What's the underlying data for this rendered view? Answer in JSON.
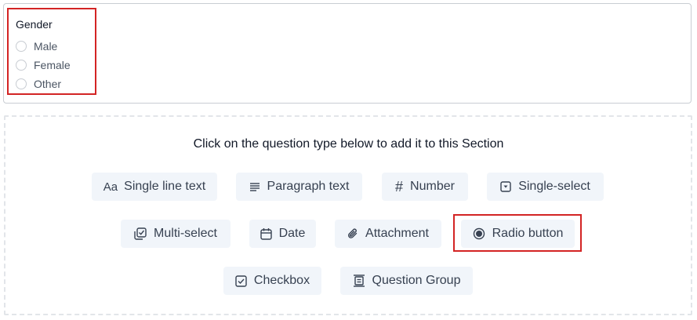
{
  "preview": {
    "field_label": "Gender",
    "options": [
      "Male",
      "Female",
      "Other"
    ]
  },
  "add_section": {
    "instruction": "Click on the question type below to add it to this Section",
    "question_types": {
      "single_line_text": "Single line text",
      "paragraph_text": "Paragraph text",
      "number": "Number",
      "single_select": "Single-select",
      "multi_select": "Multi-select",
      "date": "Date",
      "attachment": "Attachment",
      "radio_button": "Radio button",
      "checkbox": "Checkbox",
      "question_group": "Question Group"
    },
    "icon_texts": {
      "single_line_text": "Aa",
      "number": "#"
    }
  },
  "colors": {
    "highlight": "#d32424",
    "button_bg": "#f1f5fa",
    "text": "#374151"
  }
}
